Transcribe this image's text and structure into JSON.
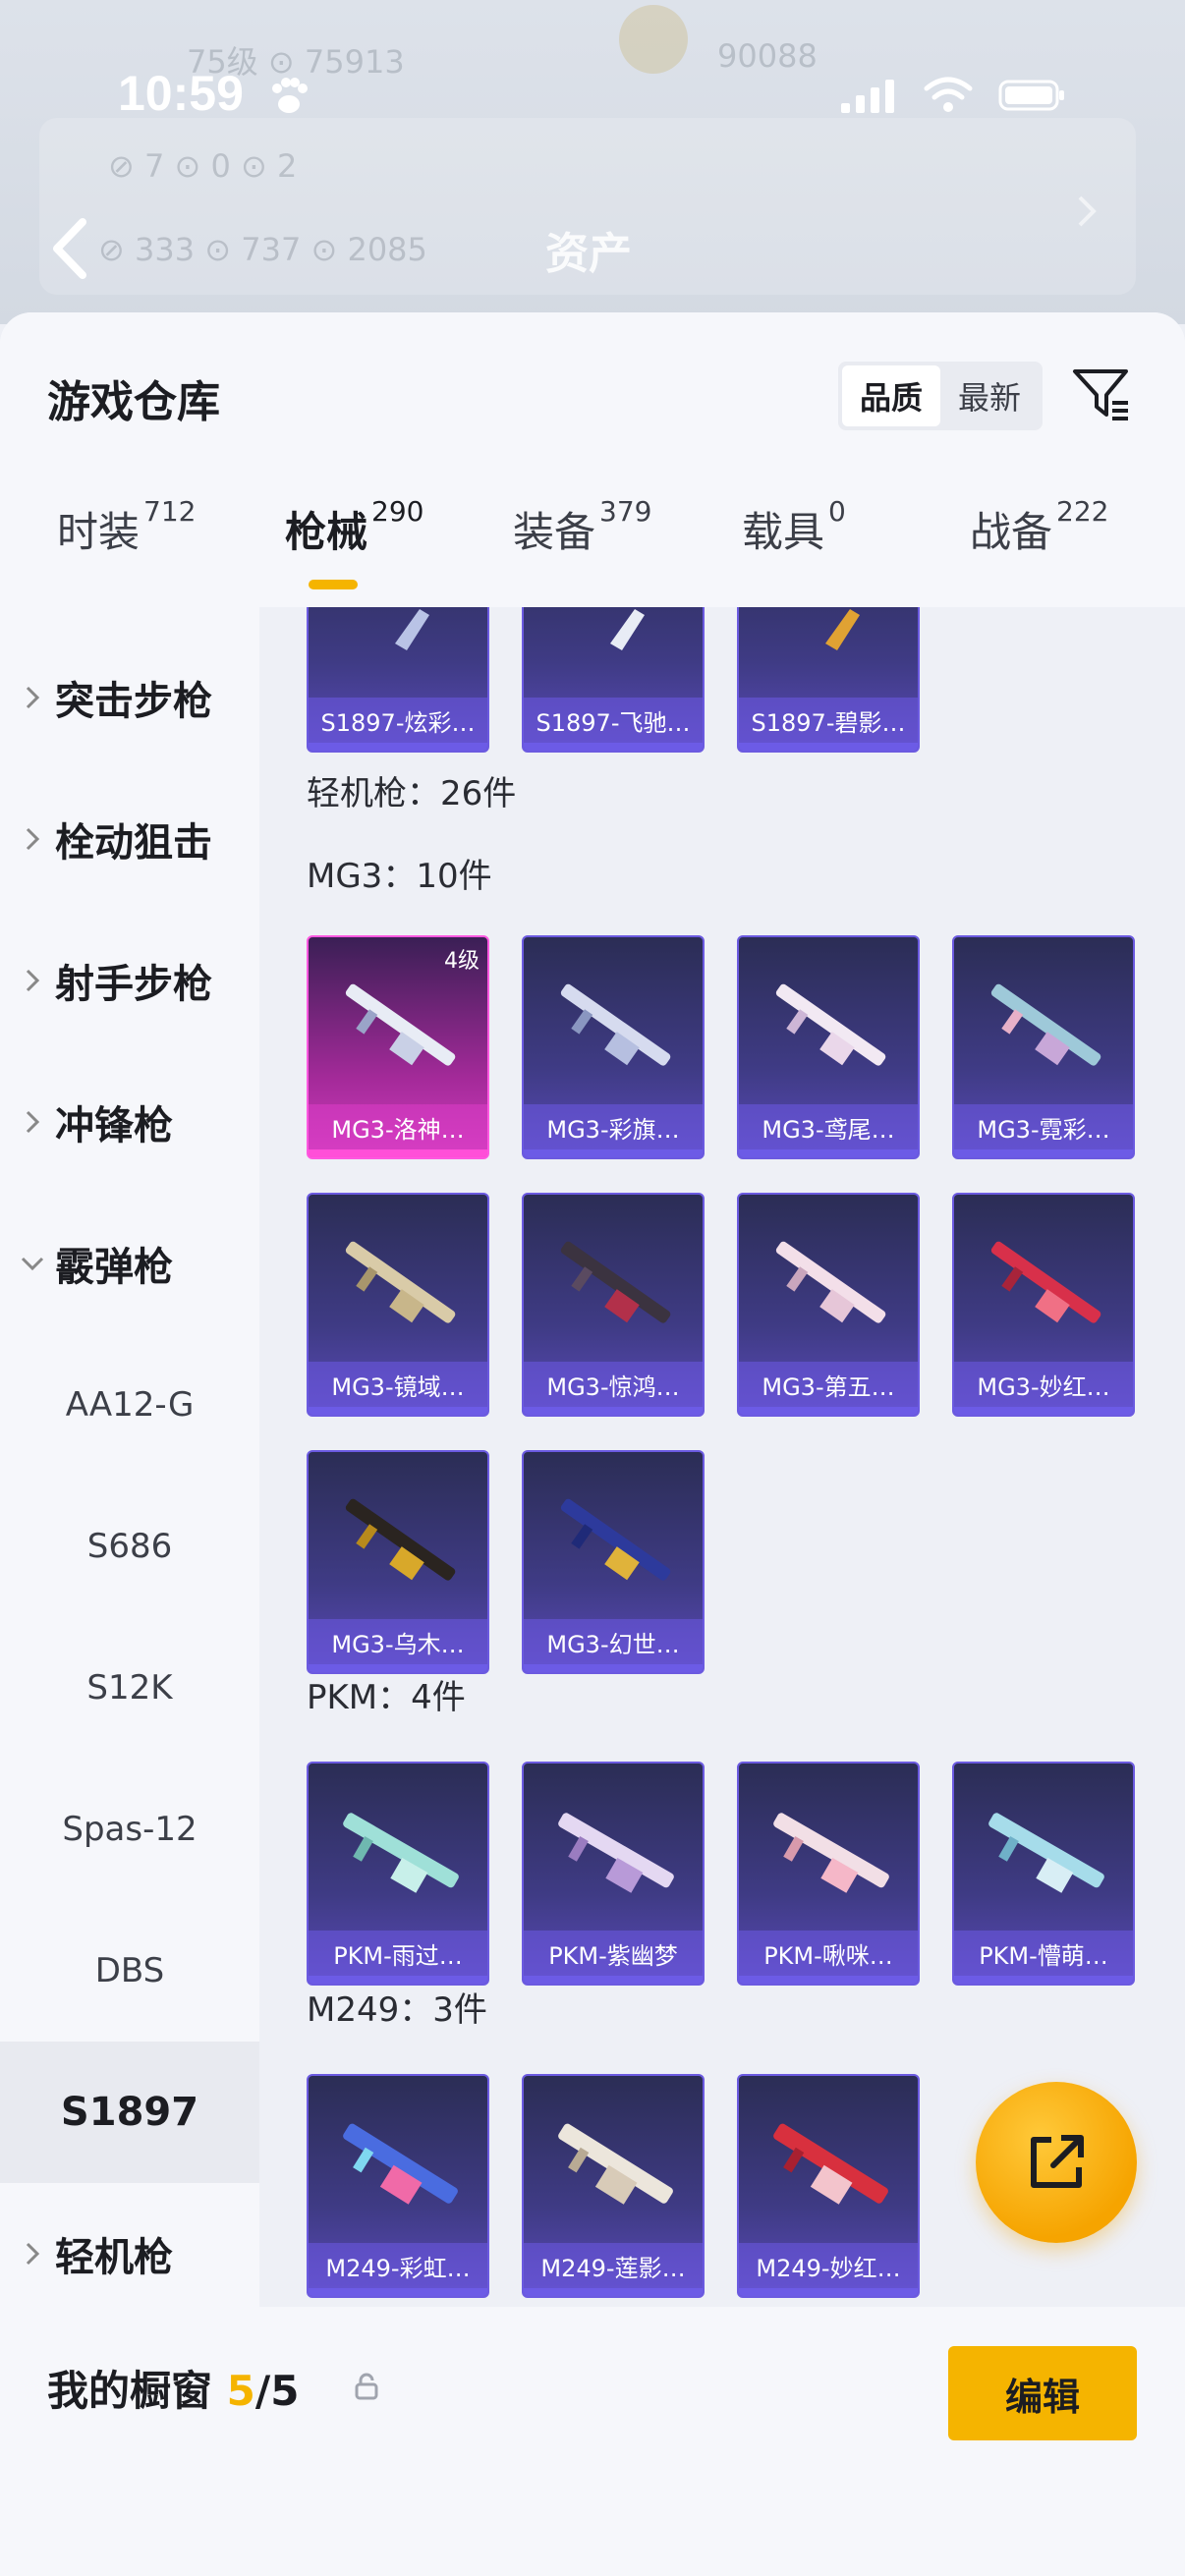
{
  "status_bar": {
    "time": "10:59"
  },
  "backdrop": {
    "page_title": "资产",
    "row1_left": "75级   ⊙ 75913",
    "row1_right": "90088",
    "row2": "⊘ 7          ⊙ 0          ⊙ 2",
    "row3": "⊘ 333       ⊙ 737                ⊙ 2085"
  },
  "header": {
    "title": "游戏仓库",
    "sort_options": [
      "品质",
      "最新"
    ],
    "active_sort": "品质"
  },
  "tabs": [
    {
      "label": "时装",
      "count": "712"
    },
    {
      "label": "枪械",
      "count": "290"
    },
    {
      "label": "装备",
      "count": "379"
    },
    {
      "label": "载具",
      "count": "0"
    },
    {
      "label": "战备",
      "count": "222"
    }
  ],
  "active_tab": "枪械",
  "rail": {
    "categories": [
      {
        "label": "突击步枪",
        "expanded": false
      },
      {
        "label": "栓动狙击",
        "expanded": false
      },
      {
        "label": "射手步枪",
        "expanded": false
      },
      {
        "label": "冲锋枪",
        "expanded": false
      },
      {
        "label": "霰弹枪",
        "expanded": true
      }
    ],
    "subitems": [
      "AA12-G",
      "S686",
      "S12K",
      "Spas-12",
      "DBS",
      "S1897"
    ],
    "selected_sub": "S1897",
    "after": [
      {
        "label": "轻机枪",
        "expanded": false
      }
    ]
  },
  "content": {
    "top_row": [
      "S1897-炫彩…",
      "S1897-飞驰…",
      "S1897-碧影…"
    ],
    "lmg_header": "轻机枪：26件",
    "mg3_header": "MG3：10件",
    "mg3_items": [
      {
        "name": "MG3-洛神…",
        "level": "4级",
        "rarity": "pink"
      },
      {
        "name": "MG3-彩旗…"
      },
      {
        "name": "MG3-鸢尾…"
      },
      {
        "name": "MG3-霓彩…"
      },
      {
        "name": "MG3-镜域…"
      },
      {
        "name": "MG3-惊鸿…"
      },
      {
        "name": "MG3-第五…"
      },
      {
        "name": "MG3-妙红…"
      },
      {
        "name": "MG3-乌木…"
      },
      {
        "name": "MG3-幻世…"
      }
    ],
    "pkm_header": "PKM：4件",
    "pkm_items": [
      "PKM-雨过…",
      "PKM-紫幽梦",
      "PKM-啾咪…",
      "PKM-懵萌…"
    ],
    "m249_header": "M249：3件",
    "m249_items": [
      "M249-彩虹…",
      "M249-莲影…",
      "M249-妙红…"
    ]
  },
  "colors": {
    "accent": "#f5b400",
    "card_purple": "#6b5ae0",
    "card_pink": "#ff58e0"
  },
  "footer": {
    "window_label": "我的橱窗",
    "window_current": "5",
    "window_total": "/5",
    "edit_label": "编辑"
  }
}
